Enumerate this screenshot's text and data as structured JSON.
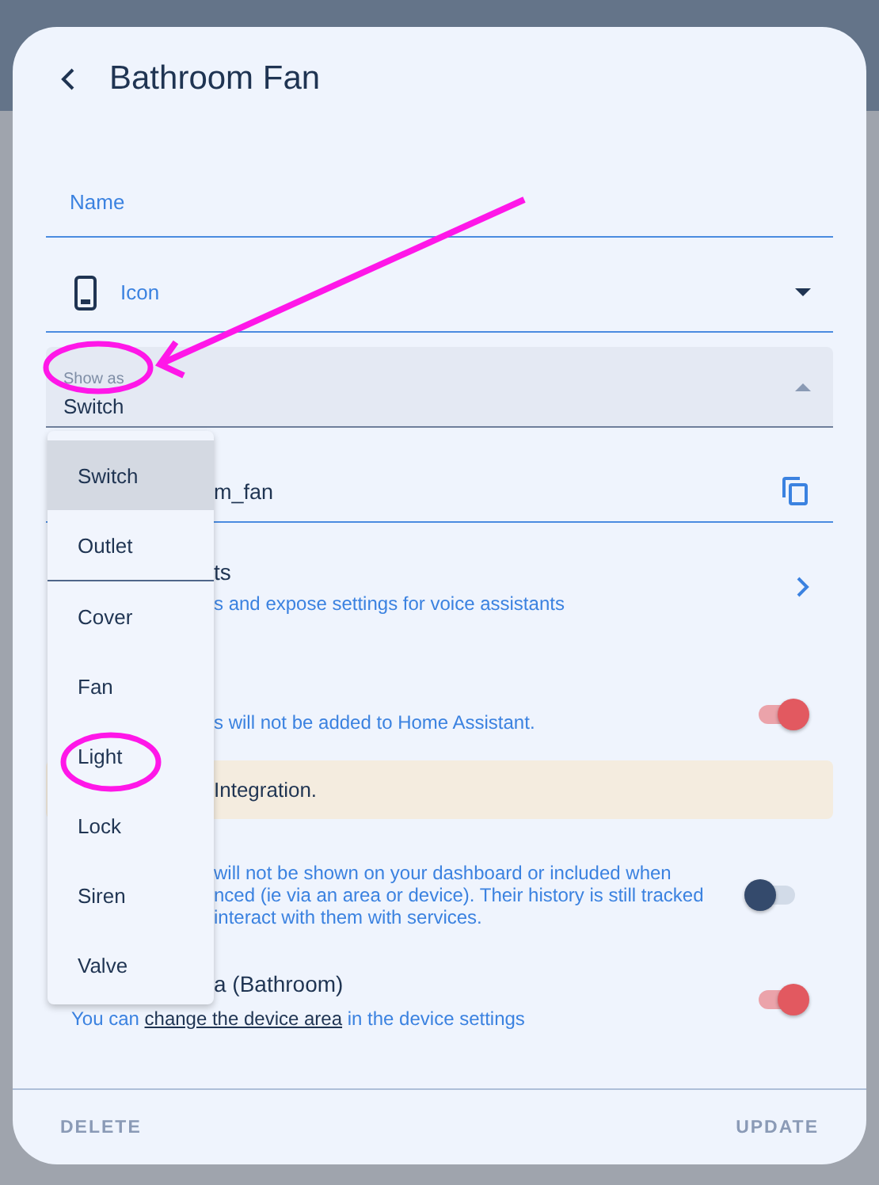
{
  "header": {
    "title": "Bathroom Fan"
  },
  "fields": [
    {
      "kind": "text",
      "label": "Name"
    },
    {
      "kind": "icon",
      "label": "Icon"
    },
    {
      "kind": "select",
      "label": "Show as",
      "value": "Switch",
      "expanded": true
    },
    {
      "kind": "copy",
      "value": "m_fan"
    }
  ],
  "menu": {
    "items": [
      {
        "label": "Switch",
        "selected": true,
        "divider_after": false
      },
      {
        "label": "Outlet",
        "selected": false,
        "divider_after": true
      },
      {
        "label": "Cover",
        "selected": false,
        "divider_after": false
      },
      {
        "label": "Fan",
        "selected": false,
        "divider_after": false
      },
      {
        "label": "Light",
        "selected": false,
        "divider_after": false
      },
      {
        "label": "Lock",
        "selected": false,
        "divider_after": false
      },
      {
        "label": "Siren",
        "selected": false,
        "divider_after": false
      },
      {
        "label": "Valve",
        "selected": false,
        "divider_after": false
      }
    ]
  },
  "rows": [
    {
      "kind": "link",
      "title": "ts",
      "subtitle": "s and expose settings for voice assistants"
    },
    {
      "kind": "toggle",
      "subtitle": "s will not be added to Home Assistant.",
      "on": true
    },
    {
      "kind": "alert",
      "text": "Integration."
    },
    {
      "kind": "toggle",
      "subtitle": "will not be shown on your dashboard or included when nced (ie via an area or device). Their history is still tracked interact with them with services.",
      "on": false
    },
    {
      "kind": "toggle",
      "title": "a (Bathroom)",
      "subtitle_before": "You can ",
      "subtitle_link": "change the device area",
      "subtitle_after": " in the device settings",
      "on": true
    }
  ],
  "buttons": [
    "DELETE",
    "UPDATE"
  ],
  "annotations": [
    {
      "kind": "arrow"
    },
    {
      "kind": "circle"
    },
    {
      "kind": "circle"
    }
  ]
}
